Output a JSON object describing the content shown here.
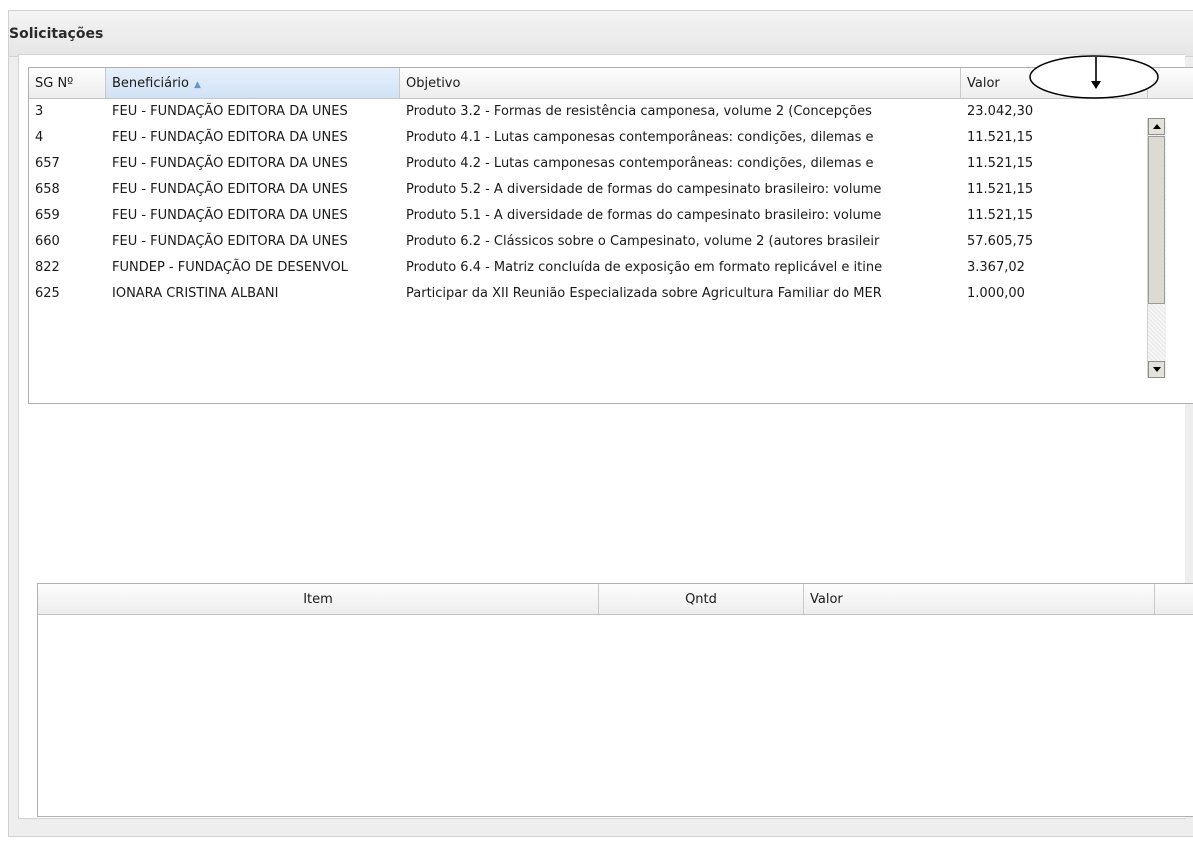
{
  "panel": {
    "title": "Solicitações"
  },
  "requests_table": {
    "columns": [
      {
        "label": "SG Nº"
      },
      {
        "label": "Beneficiário",
        "sorted": "ascending"
      },
      {
        "label": "Objetivo"
      },
      {
        "label": "Valor"
      }
    ],
    "rows": [
      {
        "sg": "3",
        "beneficiario": "FEU - FUNDAÇÃO EDITORA DA UNES",
        "objetivo": "Produto 3.2 - Formas de resistência camponesa, volume 2 (Concepções",
        "valor": "23.042,30"
      },
      {
        "sg": "4",
        "beneficiario": "FEU - FUNDAÇÃO EDITORA DA UNES",
        "objetivo": "Produto 4.1 - Lutas camponesas contemporâneas: condições, dilemas e",
        "valor": "11.521,15"
      },
      {
        "sg": "657",
        "beneficiario": "FEU - FUNDAÇÃO EDITORA DA UNES",
        "objetivo": "Produto 4.2 - Lutas camponesas contemporâneas: condições, dilemas e",
        "valor": "11.521,15"
      },
      {
        "sg": "658",
        "beneficiario": "FEU - FUNDAÇÃO EDITORA DA UNES",
        "objetivo": "Produto 5.2 - A diversidade de formas do campesinato brasileiro: volume",
        "valor": "11.521,15"
      },
      {
        "sg": "659",
        "beneficiario": "FEU - FUNDAÇÃO EDITORA DA UNES",
        "objetivo": "Produto 5.1 - A diversidade de formas do campesinato brasileiro: volume",
        "valor": "11.521,15"
      },
      {
        "sg": "660",
        "beneficiario": "FEU - FUNDAÇÃO EDITORA DA UNES",
        "objetivo": "Produto 6.2 - Clássicos sobre o Campesinato, volume 2 (autores brasileir",
        "valor": "57.605,75"
      },
      {
        "sg": "822",
        "beneficiario": "FUNDEP - FUNDAÇÃO DE DESENVOL",
        "objetivo": "Produto 6.4 - Matriz concluída de exposição em formato replicável e itine",
        "valor": "3.367,02"
      },
      {
        "sg": "625",
        "beneficiario": "IONARA CRISTINA ALBANI",
        "objetivo": "Participar da XII Reunião Especializada sobre Agricultura Familiar do MER",
        "valor": "1.000,00"
      }
    ]
  },
  "items_table": {
    "columns": [
      {
        "label": "Item"
      },
      {
        "label": "Qntd"
      },
      {
        "label": "Valor"
      }
    ],
    "rows": []
  },
  "icons": {
    "sort": "sort-ascending-icon",
    "annotation": "down-arrow-annotation-icon"
  }
}
